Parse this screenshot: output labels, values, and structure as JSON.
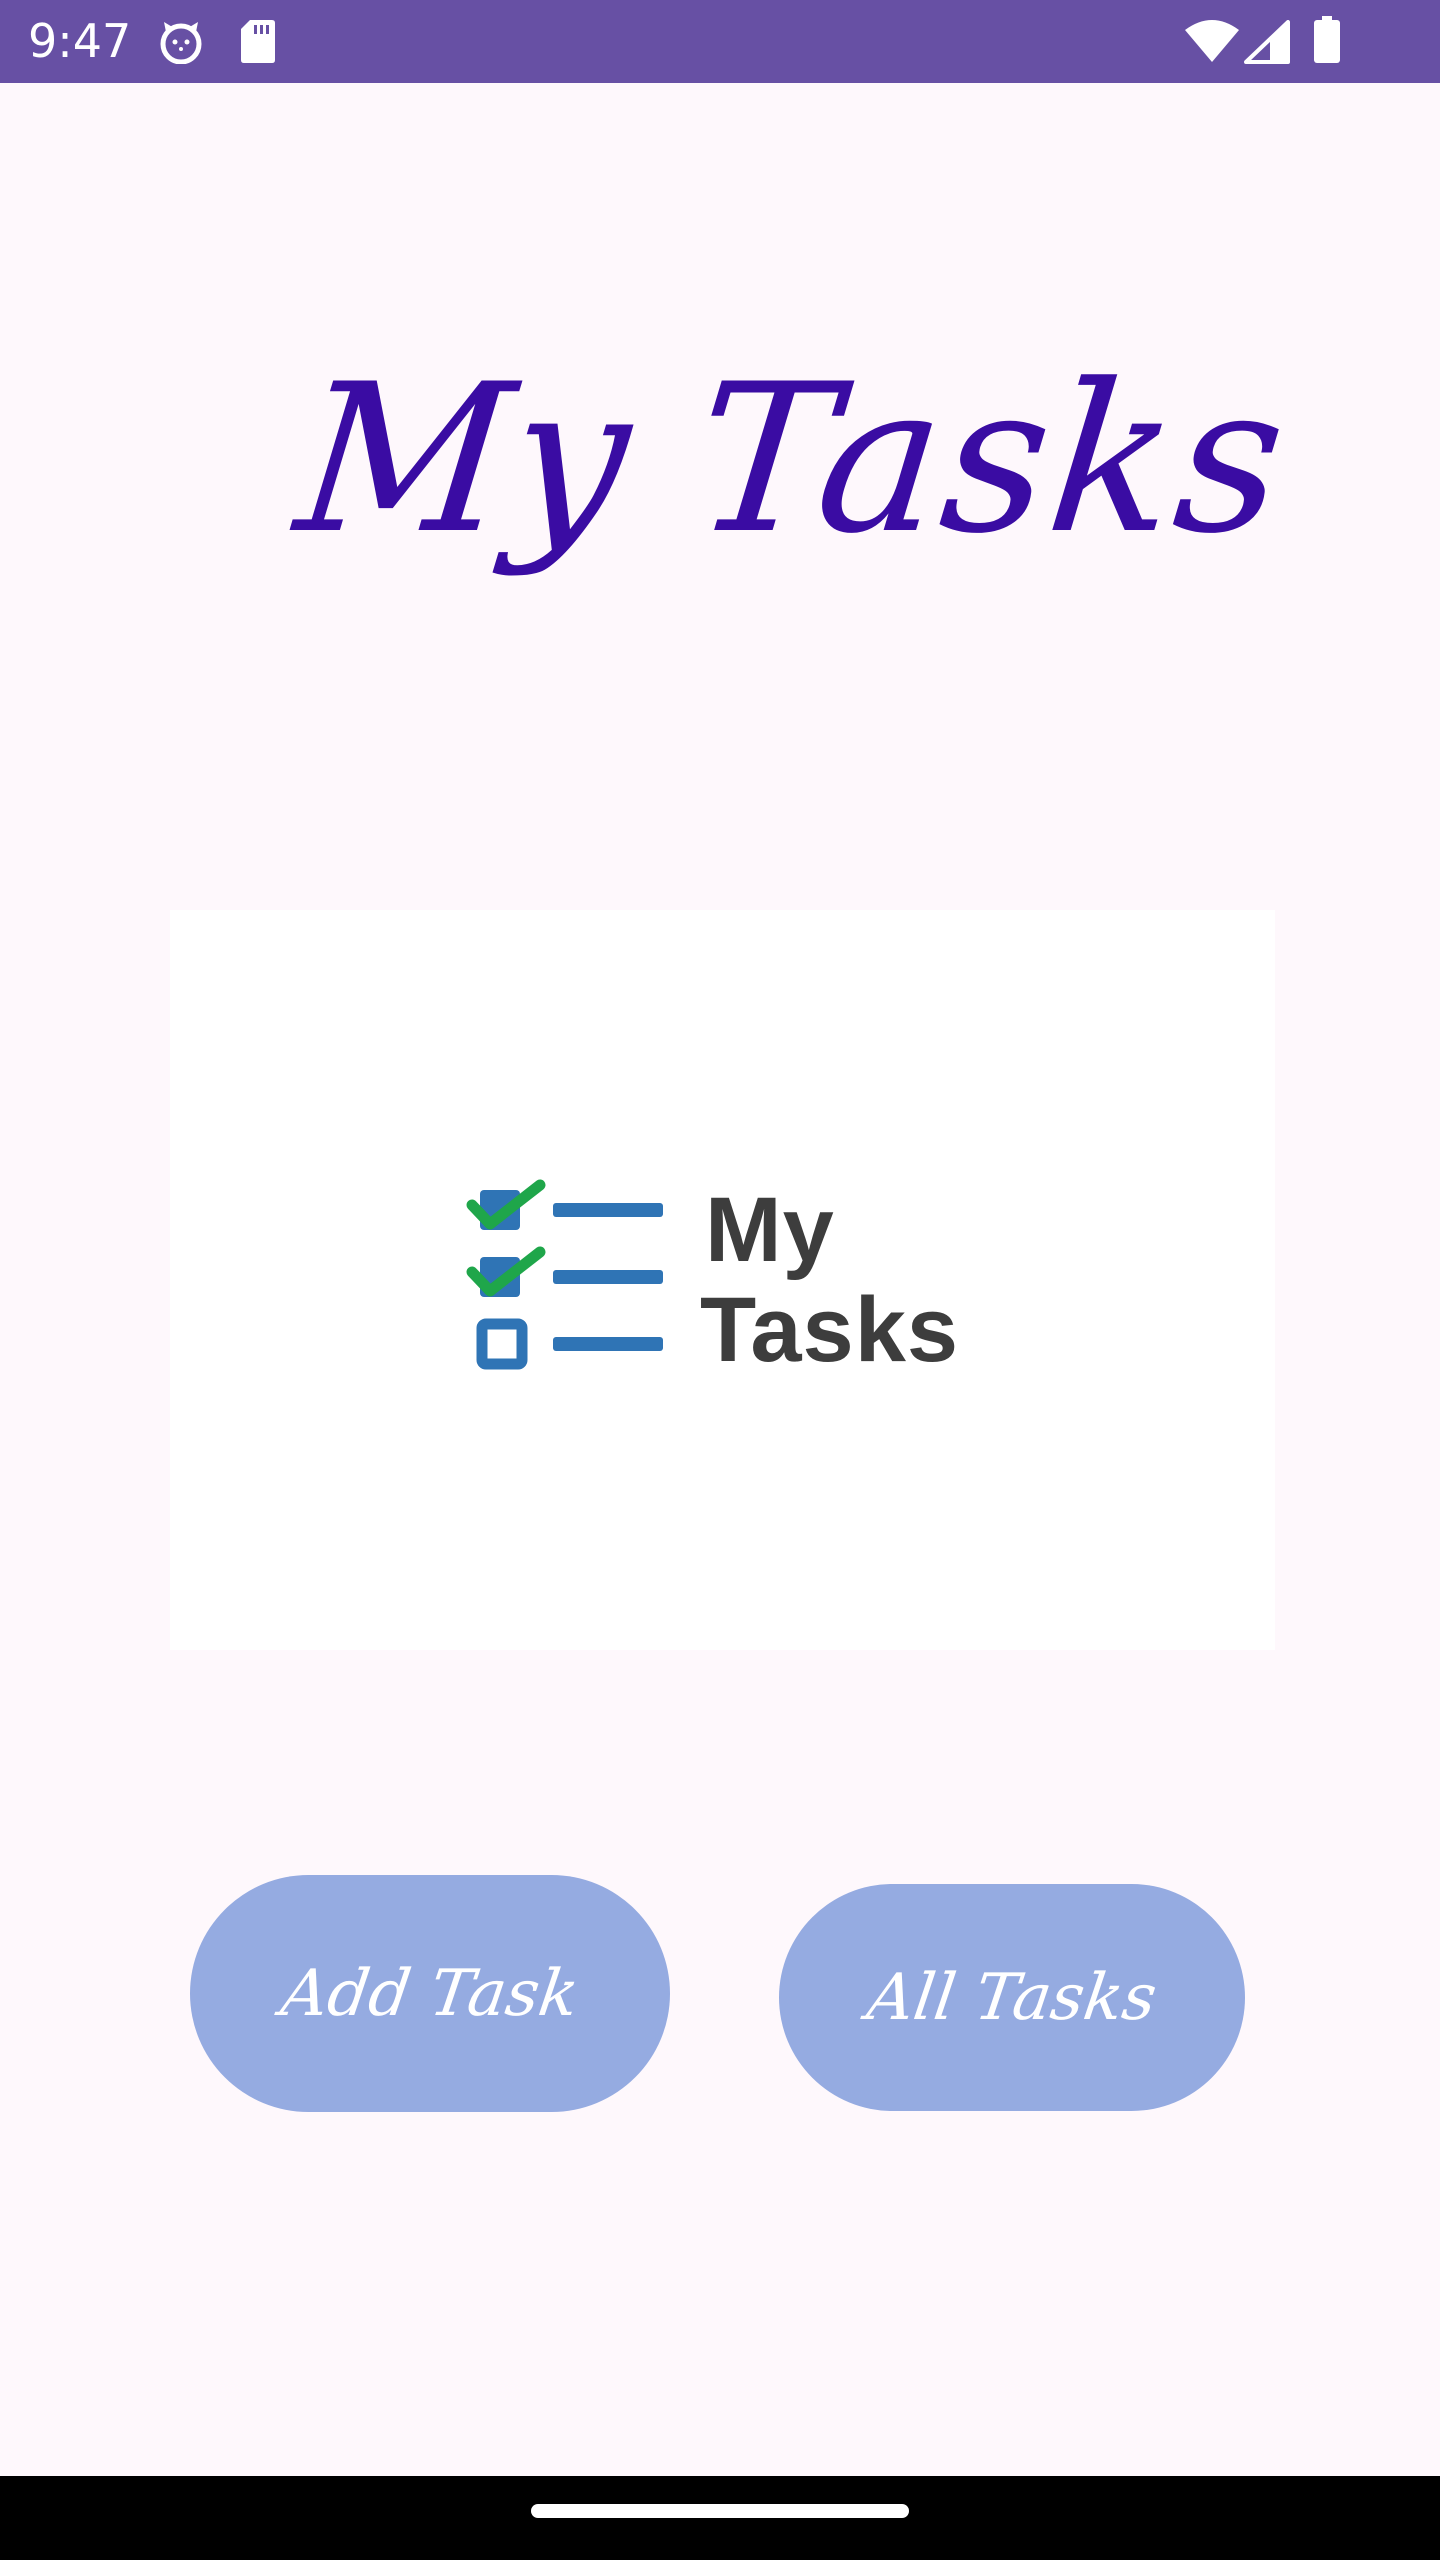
{
  "status_bar": {
    "time": "9:47",
    "icons": [
      "cat-face-icon",
      "sd-card-icon",
      "wifi-icon",
      "cell-signal-icon",
      "battery-icon"
    ],
    "background": "#6750a4"
  },
  "screen": {
    "title": "My Tasks",
    "title_color": "#3a0ca3",
    "background": "#fef8fc"
  },
  "logo": {
    "word_line1": "My",
    "word_line2": "Tasks",
    "checkbox_color": "#2f74b5",
    "check_color": "#1fa64a",
    "text_color": "#3d3d3d"
  },
  "buttons": {
    "add_task": "Add Task",
    "all_tasks": "All Tasks",
    "color": "#95abe1"
  },
  "nav_bar": {
    "icons": [
      "home-handle"
    ]
  }
}
